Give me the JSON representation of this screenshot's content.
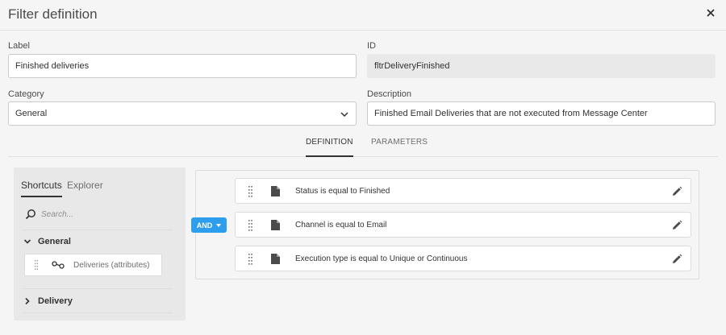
{
  "dialog": {
    "title": "Filter definition"
  },
  "form": {
    "label_label": "Label",
    "label_value": "Finished deliveries",
    "id_label": "ID",
    "id_value": "fltrDeliveryFinished",
    "category_label": "Category",
    "category_value": "General",
    "description_label": "Description",
    "description_value": "Finished Email Deliveries that are not executed from Message Center"
  },
  "tabs": [
    "DEFINITION",
    "PARAMETERS"
  ],
  "left_panel": {
    "tabs": [
      "Shortcuts",
      "Explorer"
    ],
    "search_placeholder": "Search...",
    "groups": [
      "General",
      "Delivery"
    ],
    "items": [
      "Deliveries (attributes)"
    ]
  },
  "operator": "AND",
  "conditions": [
    "Status is equal to Finished",
    "Channel is equal to Email",
    "Execution type is equal to Unique or Continuous"
  ],
  "colors": {
    "accent": "#2d9ded",
    "background": "#f5f5f5",
    "panel": "#e8e8e8"
  }
}
